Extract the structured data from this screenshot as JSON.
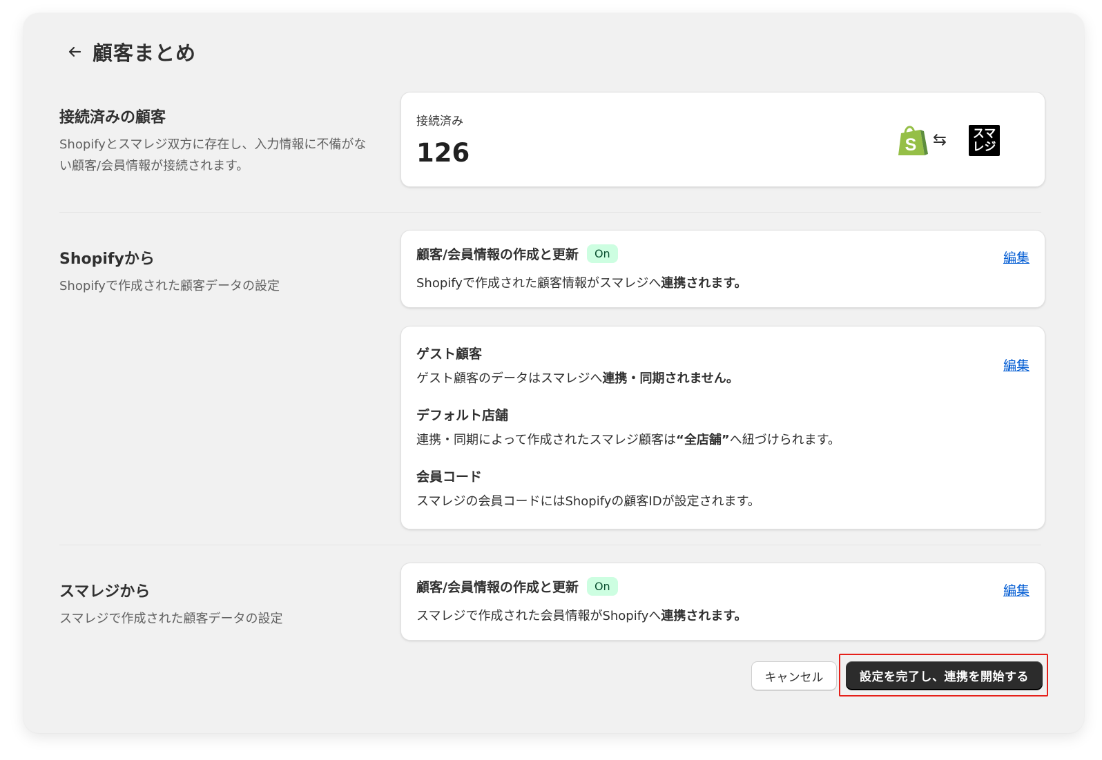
{
  "header": {
    "title": "顧客まとめ"
  },
  "connected": {
    "section_title": "接続済みの顧客",
    "section_desc": "Shopifyとスマレジ双方に存在し、入力情報に不備がない顧客/会員情報が接続されます。",
    "card_label": "接続済み",
    "count": "126",
    "sync_icon": "⇆",
    "logo_text_line1": "スマ",
    "logo_text_line2": "レジ",
    "shopify_letter": "S"
  },
  "from_shopify": {
    "section_title": "Shopifyから",
    "section_desc": "Shopifyで作成された顧客データの設定",
    "card1": {
      "heading": "顧客/会員情報の作成と更新",
      "badge": "On",
      "text_plain": "Shopifyで作成された顧客情報がスマレジへ",
      "text_bold": "連携されます。",
      "edit": "編集"
    },
    "card2": {
      "edit": "編集",
      "guest_heading": "ゲスト顧客",
      "guest_text_plain": "ゲスト顧客のデータはスマレジへ",
      "guest_text_bold": "連携・同期されません。",
      "store_heading": "デフォルト店舗",
      "store_text_plain": "連携・同期によって作成されたスマレジ顧客は",
      "store_text_bold": "“全店舗”",
      "store_text_tail": "へ紐づけられます。",
      "code_heading": "会員コード",
      "code_text": "スマレジの会員コードにはShopifyの顧客IDが設定されます。"
    }
  },
  "from_smaregi": {
    "section_title": "スマレジから",
    "section_desc": "スマレジで作成された顧客データの設定",
    "card1": {
      "heading": "顧客/会員情報の作成と更新",
      "badge": "On",
      "text_plain": "スマレジで作成された会員情報がShopifyへ",
      "text_bold": "連携されます。",
      "edit": "編集"
    }
  },
  "footer": {
    "cancel_label": "キャンセル",
    "submit_label": "設定を完了し、連携を開始する"
  },
  "colors": {
    "panel_bg": "#f1f1f1",
    "badge_bg": "#cdfee1",
    "link": "#005bd3",
    "primary_btn": "#2c2c2c",
    "highlight": "#e5201a",
    "shopify_green": "#95bf47"
  }
}
